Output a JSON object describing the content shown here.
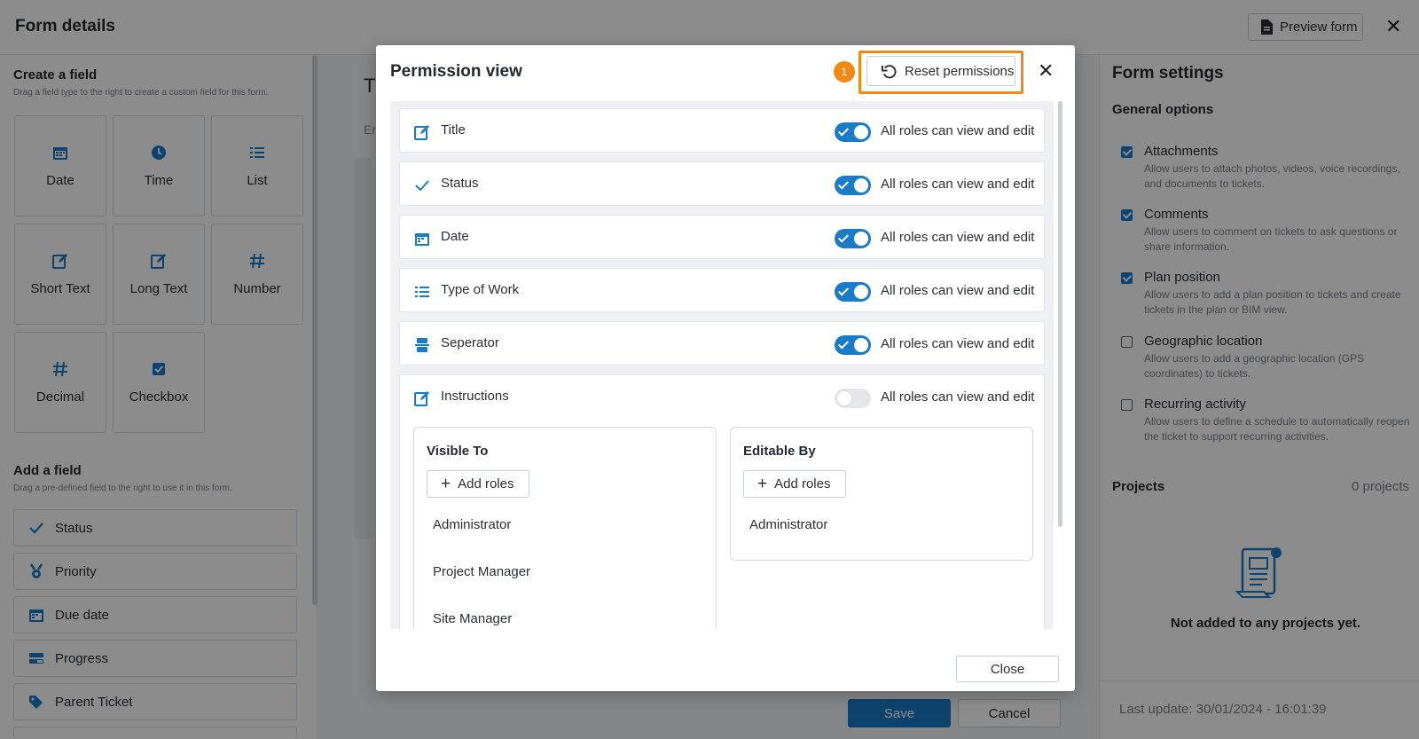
{
  "header": {
    "title": "Form details",
    "preview_label": "Preview form"
  },
  "left": {
    "create_title": "Create a field",
    "create_sub": "Drag a field type to the right to create a custom field for this form.",
    "tiles": [
      "Date",
      "Time",
      "List",
      "Short Text",
      "Long Text",
      "Number",
      "Decimal",
      "Checkbox"
    ],
    "add_title": "Add a field",
    "add_sub": "Drag a pre-defined field to the right to use it in this form.",
    "fields": [
      "Status",
      "Priority",
      "Due date",
      "Progress",
      "Parent Ticket"
    ]
  },
  "middle": {
    "letter": "T",
    "small": "Er",
    "save_label": "Save",
    "cancel_label": "Cancel"
  },
  "right": {
    "title": "Form settings",
    "general": "General options",
    "options": [
      {
        "label": "Attachments",
        "desc": "Allow users to attach photos, videos, voice recordings, and documents to tickets.",
        "checked": true
      },
      {
        "label": "Comments",
        "desc": "Allow users to comment on tickets to ask questions or share information.",
        "checked": true
      },
      {
        "label": "Plan position",
        "desc": "Allow users to add a plan position to tickets and create tickets in the plan or BIM view.",
        "checked": true
      },
      {
        "label": "Geographic location",
        "desc": "Allow users to add a geographic location (GPS coordinates) to tickets.",
        "checked": false
      },
      {
        "label": "Recurring activity",
        "desc": "Allow users to define a schedule to automatically reopen the ticket to support recurring activities.",
        "checked": false
      }
    ],
    "projects_title": "Projects",
    "projects_count": "0 projects",
    "projects_empty": "Not added to any projects yet.",
    "last_update": "Last update: 30/01/2024 - 16:01:39"
  },
  "modal": {
    "title": "Permission view",
    "reset_label": "Reset permissions",
    "badge": "1",
    "close_label": "Close",
    "rows": [
      {
        "label": "Title",
        "icon": "edit-icon",
        "text": "All roles can view and edit",
        "on": true
      },
      {
        "label": "Status",
        "icon": "check-icon",
        "text": "All roles can view and edit",
        "on": true
      },
      {
        "label": "Date",
        "icon": "calendar-icon",
        "text": "All roles can view and edit",
        "on": true
      },
      {
        "label": "Type of Work",
        "icon": "list-icon",
        "text": "All roles can view and edit",
        "on": true
      },
      {
        "label": "Seperator",
        "icon": "separator-icon",
        "text": "All roles can view and edit",
        "on": true
      },
      {
        "label": "Instructions",
        "icon": "edit-icon",
        "text": "All roles can view and edit",
        "on": false
      }
    ],
    "visible_to": {
      "title": "Visible To",
      "add_label": "Add roles",
      "roles": [
        "Administrator",
        "Project Manager",
        "Site Manager"
      ]
    },
    "editable_by": {
      "title": "Editable By",
      "add_label": "Add roles",
      "roles": [
        "Administrator"
      ]
    }
  },
  "colors": {
    "accent": "#1a7bc9",
    "highlight": "#f08a14"
  }
}
